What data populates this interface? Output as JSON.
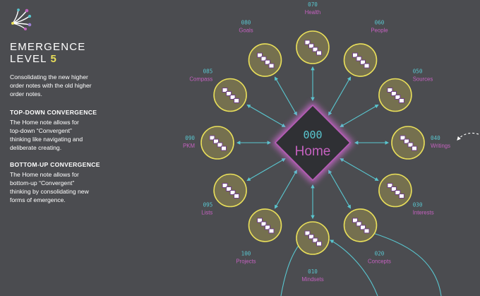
{
  "sidebar": {
    "level_title": "EMERGENCE",
    "level_word": "LEVEL",
    "level_number": "5",
    "intro_lines": [
      "Consolidating the new higher",
      "order notes with the old higher",
      "order notes."
    ],
    "sections": [
      {
        "heading": "TOP-DOWN CONVERGENCE",
        "body_lines": [
          "The Home note allows for",
          "top-down “Convergent”",
          "thinking like navigating and",
          "deliberate creating."
        ]
      },
      {
        "heading": "BOTTOM-UP CONVERGENCE",
        "body_lines": [
          "The Home note allows for",
          "bottom-up “Convergent”",
          "thinking by consolidating new",
          "forms of emergence."
        ]
      }
    ]
  },
  "center": {
    "code": "000",
    "label": "Home"
  },
  "nodes": [
    {
      "code": "070",
      "label": "Health"
    },
    {
      "code": "060",
      "label": "People"
    },
    {
      "code": "050",
      "label": "Sources"
    },
    {
      "code": "040",
      "label": "Writings"
    },
    {
      "code": "030",
      "label": "Interests"
    },
    {
      "code": "020",
      "label": "Concepts"
    },
    {
      "code": "010",
      "label": "Mindsets"
    },
    {
      "code": "100",
      "label": "Projects"
    },
    {
      "code": "095",
      "label": "Lists"
    },
    {
      "code": "090",
      "label": "PKM"
    },
    {
      "code": "085",
      "label": "Compass"
    },
    {
      "code": "080",
      "label": "Goals"
    }
  ],
  "colors": {
    "background": "#4b4c50",
    "node_fill": "#75704f",
    "node_ring": "#e9df5a",
    "accent_teal": "#59c6cf",
    "accent_purple": "#c461bf",
    "home_fill": "#2f3034",
    "glow": "#c767c9"
  },
  "icons": {
    "logo": "starburst-logo-icon",
    "node": "stacked-notes-icon"
  }
}
